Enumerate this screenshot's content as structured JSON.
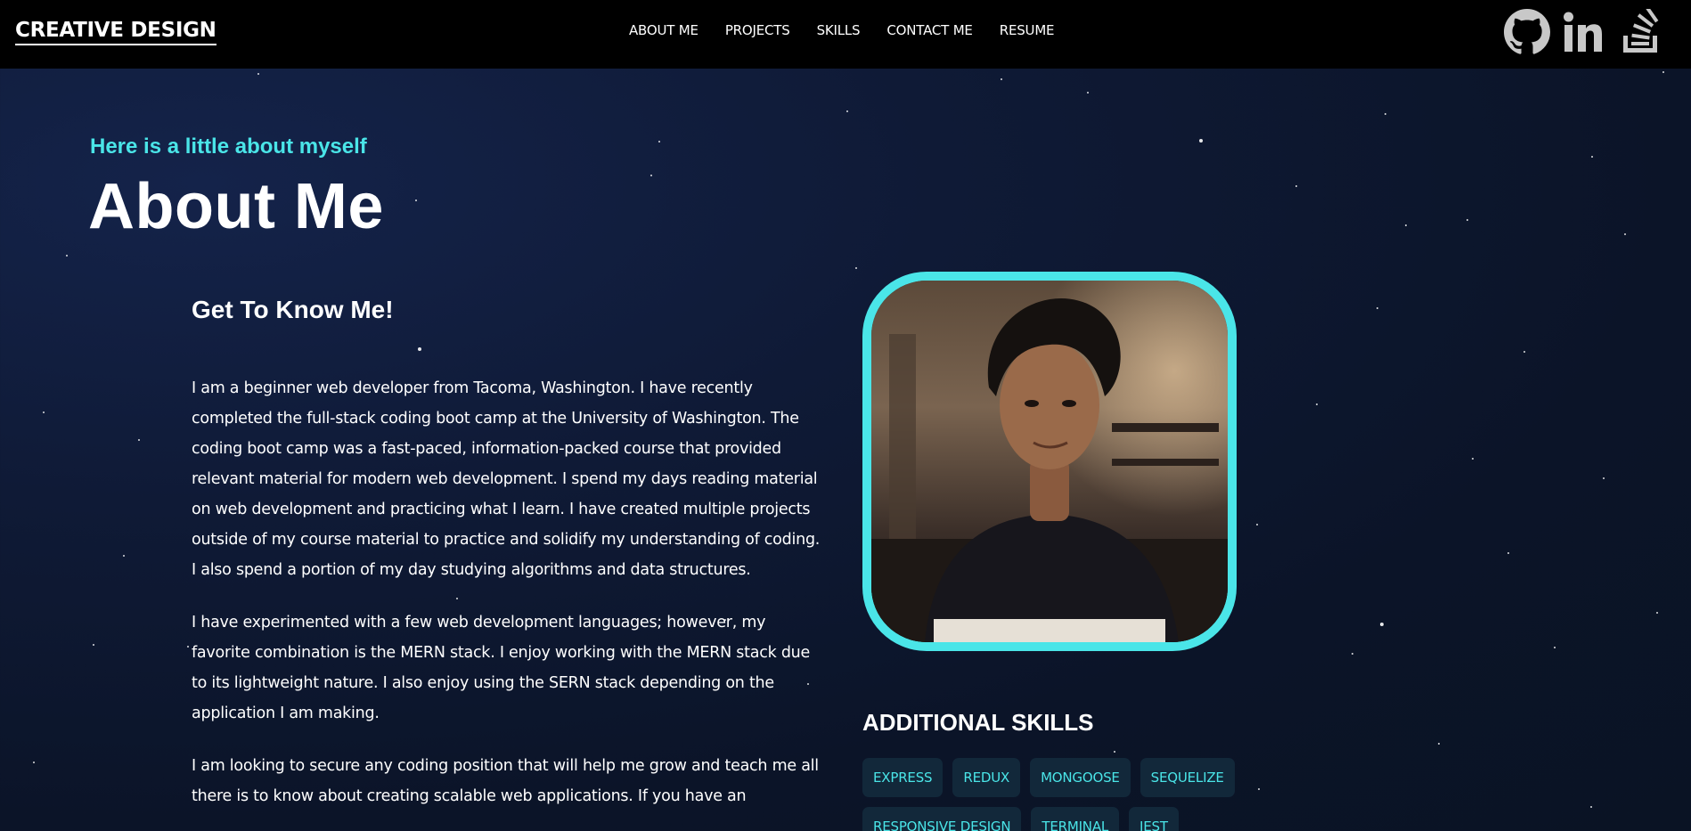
{
  "nav": {
    "brand": "CREATIVE DESIGN",
    "links": [
      "ABOUT ME",
      "PROJECTS",
      "SKILLS",
      "CONTACT ME",
      "RESUME"
    ],
    "social_icons": [
      "github-icon",
      "linkedin-icon",
      "stack-overflow-icon"
    ]
  },
  "about": {
    "kicker": "Here is a little about myself",
    "title": "About Me",
    "heading": "Get To Know Me!",
    "paragraphs": [
      "I am a beginner web developer from Tacoma, Washington. I have recently completed the full-stack coding boot camp at the University of Washington. The coding boot camp was a fast-paced, information-packed course that provided relevant material for modern web development. I spend my days reading material on web development and practicing what I learn. I have created multiple projects outside of my course material to practice and solidify my understanding of coding. I also spend a portion of my day studying algorithms and data structures.",
      "I have experimented with a few web development languages; however, my favorite combination is the MERN stack. I enjoy working with the MERN stack due to its lightweight nature. I also enjoy using the SERN stack depending on the application I am making.",
      "I am looking to secure any coding position that will help me grow and teach me all there is to know about creating scalable web applications. If you have an"
    ]
  },
  "skills": {
    "heading": "ADDITIONAL SKILLS",
    "items": [
      "EXPRESS",
      "REDUX",
      "MONGOOSE",
      "SEQUELIZE",
      "RESPONSIVE DESIGN",
      "TERMINAL",
      "JEST"
    ]
  },
  "colors": {
    "accent": "#4ae5e8",
    "navbar": "#000000",
    "background": "#0f1a36",
    "chip_bg": "#12283a"
  }
}
